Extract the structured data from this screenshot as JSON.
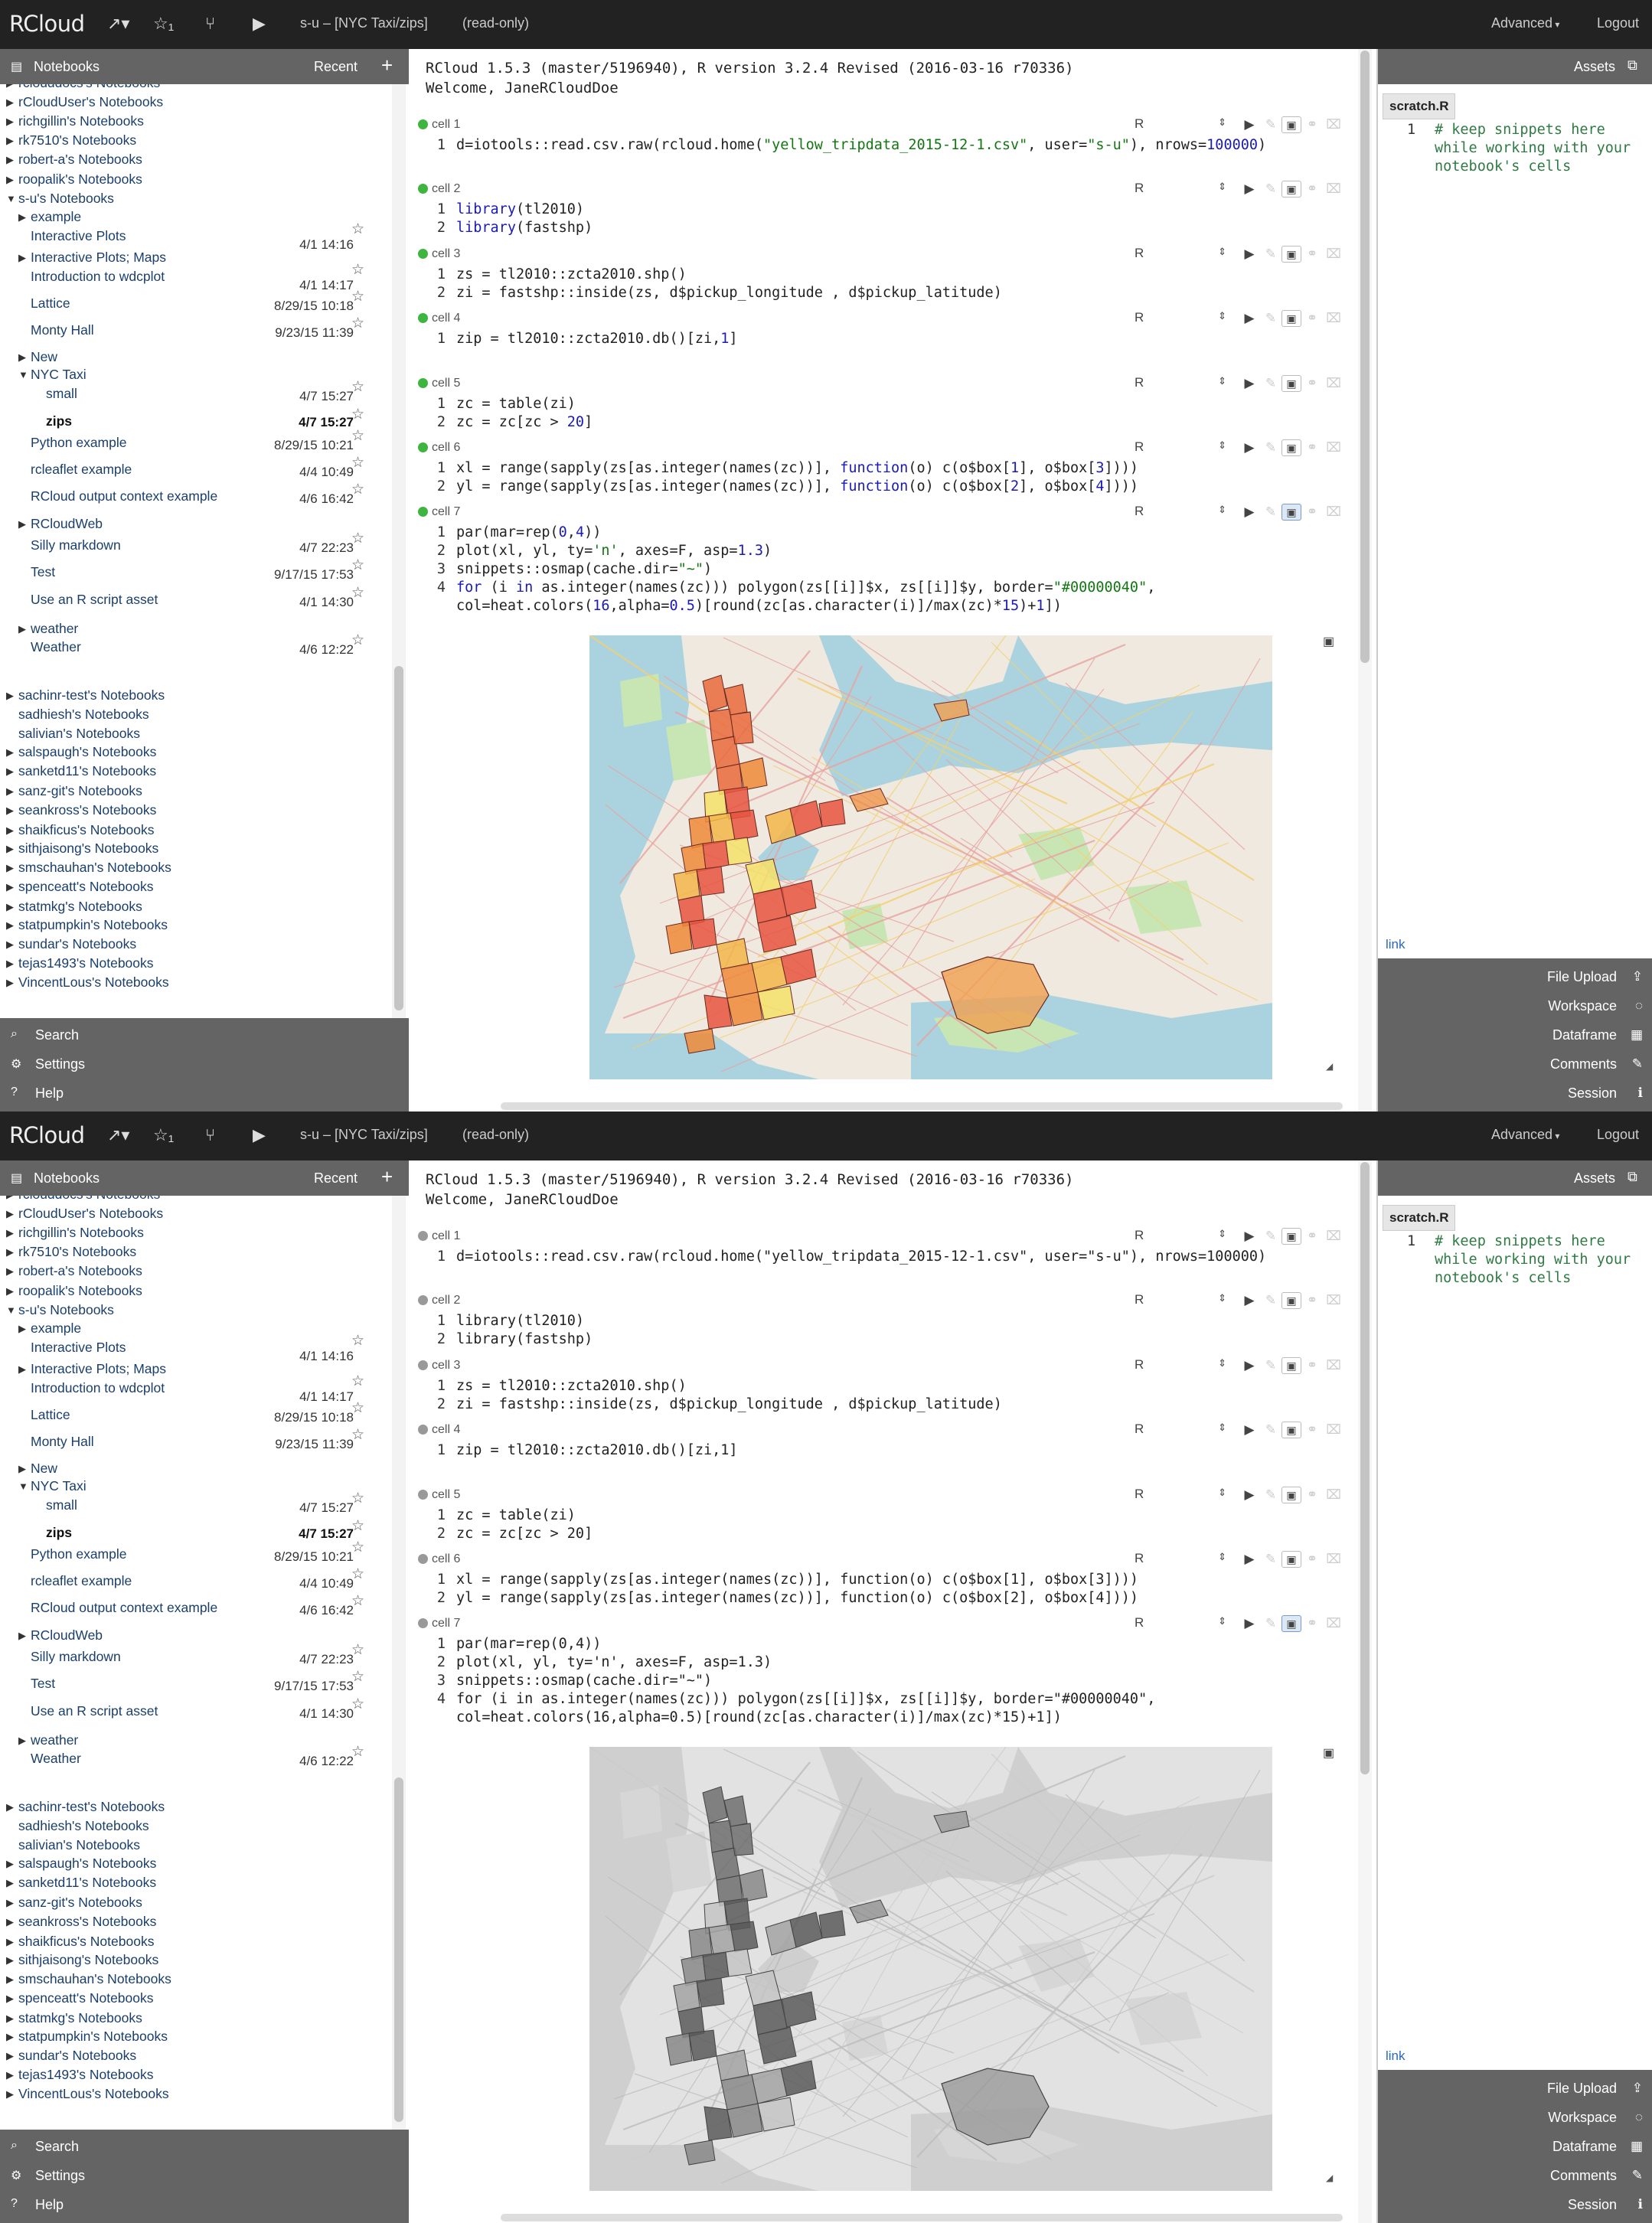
{
  "colors": {
    "navbar": "#222222",
    "panel_header": "#646464",
    "cell_dot_run": "#3eb53e",
    "cell_dot_idle": "#999999",
    "link": "#1a3f6b",
    "comment": "#2e7b43",
    "keyword": "#1a1ab8",
    "string": "#117711"
  },
  "screens": [
    {
      "state": "highlighted",
      "map_style": "color",
      "dot": "run"
    },
    {
      "state": "plain",
      "map_style": "gray",
      "dot": "idle"
    }
  ],
  "navbar": {
    "brand": "RCloud",
    "icons": [
      "share-icon",
      "star-icon",
      "fork-icon",
      "play-icon"
    ],
    "title": "s-u – [NYC Taxi/zips]",
    "readonly": "(read-only)",
    "advanced": "Advanced",
    "logout": "Logout"
  },
  "left_panel": {
    "header": {
      "label": "Notebooks",
      "recent": "Recent",
      "add": "+"
    },
    "tree": [
      {
        "label": "rclouddocs's Notebooks",
        "toggle": "▶",
        "indent": 0
      },
      {
        "label": "rCloudUser's Notebooks",
        "toggle": "▶",
        "indent": 0
      },
      {
        "label": "richgillin's Notebooks",
        "toggle": "▶",
        "indent": 0
      },
      {
        "label": "rk7510's Notebooks",
        "toggle": "▶",
        "indent": 0
      },
      {
        "label": "robert-a's Notebooks",
        "toggle": "▶",
        "indent": 0
      },
      {
        "label": "roopalik's Notebooks",
        "toggle": "▶",
        "indent": 0
      },
      {
        "label": "s-u's Notebooks",
        "toggle": "▼",
        "indent": 0
      },
      {
        "label": "example",
        "toggle": "▶",
        "indent": 1
      },
      {
        "label": "Interactive Plots",
        "indent": 1,
        "date": "4/1 14:16",
        "star": true
      },
      {
        "label": "Interactive Plots; Maps",
        "toggle": "▶",
        "indent": 1
      },
      {
        "label": "Introduction to wdcplot",
        "indent": 1,
        "date": "4/1 14:17",
        "star": true
      },
      {
        "label": "Lattice",
        "indent": 1,
        "date": "8/29/15 10:18",
        "star": true
      },
      {
        "label": "Monty Hall",
        "indent": 1,
        "date": "9/23/15 11:39",
        "star": true
      },
      {
        "label": "New",
        "toggle": "▶",
        "indent": 1
      },
      {
        "label": "NYC Taxi",
        "toggle": "▼",
        "indent": 1
      },
      {
        "label": "small",
        "indent": 2,
        "date": "4/7 15:27",
        "star": true
      },
      {
        "label": "zips",
        "indent": 2,
        "date": "4/7 15:27",
        "star": true,
        "bold": true
      },
      {
        "label": "Python example",
        "indent": 1,
        "date": "8/29/15 10:21",
        "star": true
      },
      {
        "label": "rcleaflet example",
        "indent": 1,
        "date": "4/4 10:49",
        "star": true
      },
      {
        "label": "RCloud output context example",
        "indent": 1,
        "date": "4/6 16:42",
        "star": true
      },
      {
        "label": "RCloudWeb",
        "toggle": "▶",
        "indent": 1
      },
      {
        "label": "Silly markdown",
        "indent": 1,
        "date": "4/7 22:23",
        "star": true
      },
      {
        "label": "Test",
        "indent": 1,
        "date": "9/17/15 17:53",
        "star": true
      },
      {
        "label": "Use an R script asset",
        "indent": 1,
        "date": "4/1 14:30",
        "star": true
      },
      {
        "label": "weather",
        "toggle": "▶",
        "indent": 1
      },
      {
        "label": "Weather",
        "indent": 1,
        "date": "4/6 12:22",
        "star": true
      },
      {
        "label": "sachinr-test's Notebooks",
        "toggle": "▶",
        "indent": 0
      },
      {
        "label": "sadhiesh's Notebooks",
        "indent": 0
      },
      {
        "label": "salivian's Notebooks",
        "indent": 0
      },
      {
        "label": "salspaugh's Notebooks",
        "toggle": "▶",
        "indent": 0
      },
      {
        "label": "sanketd11's Notebooks",
        "toggle": "▶",
        "indent": 0
      },
      {
        "label": "sanz-git's Notebooks",
        "toggle": "▶",
        "indent": 0
      },
      {
        "label": "seankross's Notebooks",
        "toggle": "▶",
        "indent": 0
      },
      {
        "label": "shaikficus's Notebooks",
        "toggle": "▶",
        "indent": 0
      },
      {
        "label": "sithjaisong's Notebooks",
        "toggle": "▶",
        "indent": 0
      },
      {
        "label": "smschauhan's Notebooks",
        "toggle": "▶",
        "indent": 0
      },
      {
        "label": "spenceatt's Notebooks",
        "toggle": "▶",
        "indent": 0
      },
      {
        "label": "statmkg's Notebooks",
        "toggle": "▶",
        "indent": 0
      },
      {
        "label": "statpumpkin's Notebooks",
        "toggle": "▶",
        "indent": 0
      },
      {
        "label": "sundar's Notebooks",
        "toggle": "▶",
        "indent": 0
      },
      {
        "label": "tejas1493's Notebooks",
        "toggle": "▶",
        "indent": 0
      },
      {
        "label": "VincentLous's Notebooks",
        "toggle": "▶",
        "indent": 0
      }
    ],
    "footer": [
      {
        "label": "Search",
        "icon": "search-icon",
        "glyph": "⌕"
      },
      {
        "label": "Settings",
        "icon": "gear-icon",
        "glyph": "⚙"
      },
      {
        "label": "Help",
        "icon": "help-icon",
        "glyph": "?"
      }
    ]
  },
  "main": {
    "welcome": "RCloud 1.5.3 (master/5196940), R version 3.2.4 Revised (2016-03-16 r70336)\nWelcome, JaneRCloudDoe",
    "language": "R",
    "cells": [
      {
        "label": "cell 1",
        "lines": [
          [
            [
              "",
              "d=iotools::read.csv.raw(rcloud.home("
            ],
            [
              "st",
              "\"yellow_tripdata_2015-12-1.csv\""
            ],
            [
              "",
              ", user="
            ],
            [
              "st",
              "\"s-u\""
            ],
            [
              "",
              "), nrows="
            ],
            [
              "nm",
              "100000"
            ],
            [
              "",
              ")"
            ]
          ]
        ]
      },
      {
        "label": "cell 2",
        "lines": [
          [
            [
              "kw",
              "library"
            ],
            [
              "",
              "(tl2010)"
            ]
          ],
          [
            [
              "kw",
              "library"
            ],
            [
              "",
              "(fastshp)"
            ]
          ]
        ]
      },
      {
        "label": "cell 3",
        "lines": [
          [
            [
              "",
              "zs = tl2010::zcta2010.shp()"
            ]
          ],
          [
            [
              "",
              "zi = fastshp::inside(zs, d$pickup_longitude , d$pickup_latitude)"
            ]
          ]
        ]
      },
      {
        "label": "cell 4",
        "lines": [
          [
            [
              "",
              "zip = tl2010::zcta2010.db()[zi,"
            ],
            [
              "nm",
              "1"
            ],
            [
              "",
              "]"
            ]
          ]
        ]
      },
      {
        "label": "cell 5",
        "lines": [
          [
            [
              "",
              "zc = table(zi)"
            ]
          ],
          [
            [
              "",
              "zc = zc[zc > "
            ],
            [
              "nm",
              "20"
            ],
            [
              "",
              "]"
            ]
          ]
        ]
      },
      {
        "label": "cell 6",
        "lines": [
          [
            [
              "",
              "xl = range(sapply(zs[as.integer(names(zc))], "
            ],
            [
              "kw",
              "function"
            ],
            [
              "",
              "(o) c(o$box["
            ],
            [
              "nm",
              "1"
            ],
            [
              "",
              "], o$box["
            ],
            [
              "nm",
              "3"
            ],
            [
              "",
              "])))"
            ]
          ],
          [
            [
              "",
              "yl = range(sapply(zs[as.integer(names(zc))], "
            ],
            [
              "kw",
              "function"
            ],
            [
              "",
              "(o) c(o$box["
            ],
            [
              "nm",
              "2"
            ],
            [
              "",
              "], o$box["
            ],
            [
              "nm",
              "4"
            ],
            [
              "",
              "])))"
            ]
          ]
        ]
      },
      {
        "label": "cell 7",
        "lines": [
          [
            [
              "",
              "par(mar=rep("
            ],
            [
              "nm",
              "0"
            ],
            [
              "",
              ","
            ],
            [
              "nm",
              "4"
            ],
            [
              "",
              "))"
            ]
          ],
          [
            [
              "",
              "plot(xl, yl, ty="
            ],
            [
              "st",
              "'n'"
            ],
            [
              "",
              ", axes=F, asp="
            ],
            [
              "nm",
              "1.3"
            ],
            [
              "",
              ")"
            ]
          ],
          [
            [
              "",
              "snippets::osmap(cache.dir="
            ],
            [
              "st",
              "\"~\""
            ],
            [
              "",
              ")"
            ]
          ],
          [
            [
              "kw",
              "for"
            ],
            [
              "",
              " (i "
            ],
            [
              "kw",
              "in"
            ],
            [
              "",
              " as.integer(names(zc))) polygon(zs[[i]]$x, zs[[i]]$y, border="
            ],
            [
              "st",
              "\"#00000040\""
            ],
            [
              "",
              ","
            ]
          ],
          [
            [
              "",
              "col=heat.colors("
            ],
            [
              "nm",
              "16"
            ],
            [
              "",
              ",alpha="
            ],
            [
              "nm",
              "0.5"
            ],
            [
              "",
              ")[round(zc[as.character(i)]/max(zc)*"
            ],
            [
              "nm",
              "15"
            ],
            [
              "",
              ")+"
            ],
            [
              "nm",
              "1"
            ],
            [
              "",
              "])"
            ]
          ]
        ]
      }
    ]
  },
  "right_panel": {
    "header": "Assets",
    "tab": "scratch.R",
    "line_no": "1",
    "snippet": "# keep snippets here while working with your notebook's cells",
    "link": "link",
    "footer": [
      {
        "label": "File Upload",
        "icon": "upload-icon",
        "glyph": "⇪"
      },
      {
        "label": "Workspace",
        "icon": "workspace-icon",
        "glyph": "◌"
      },
      {
        "label": "Dataframe",
        "icon": "table-icon",
        "glyph": "▦"
      },
      {
        "label": "Comments",
        "icon": "comments-icon",
        "glyph": "✎"
      },
      {
        "label": "Session",
        "icon": "info-icon",
        "glyph": "ℹ"
      }
    ]
  }
}
